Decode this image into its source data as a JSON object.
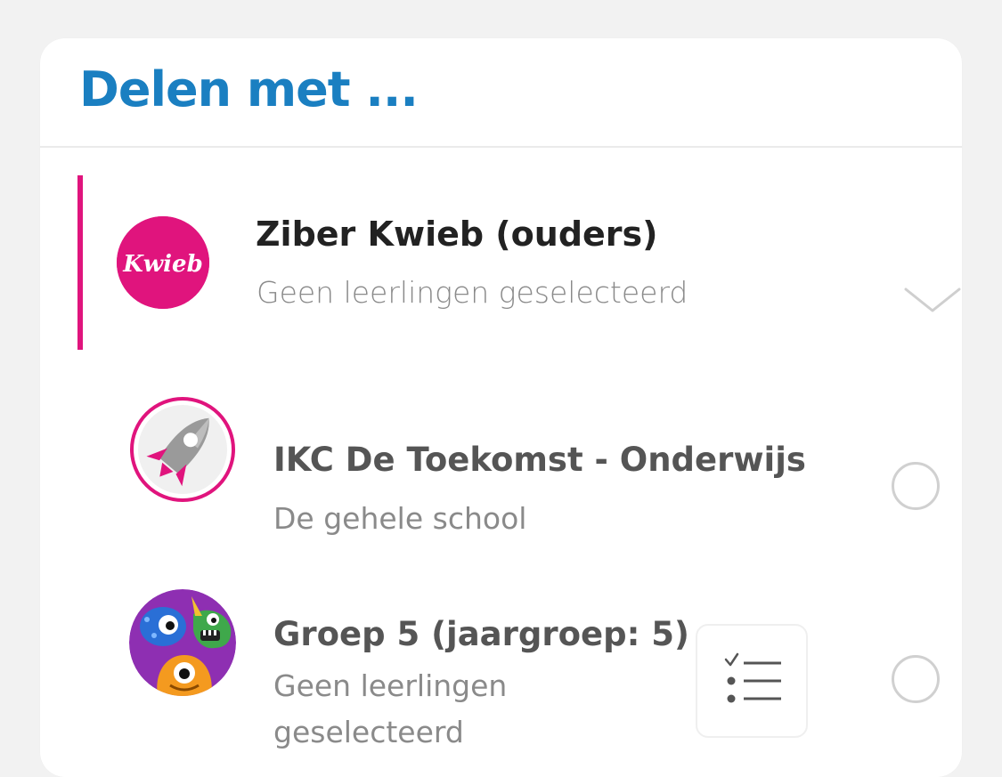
{
  "dialog": {
    "title": "Delen met ..."
  },
  "parent_group": {
    "name": "Ziber Kwieb (ouders)",
    "subtitle": "Geen leerlingen geselecteerd",
    "logo_text": "Kwieb",
    "accent_color": "#e0147d",
    "expand_icon": "chevron-down-icon"
  },
  "items": [
    {
      "name": "IKC De Toekomst - Onderwijs",
      "subtitle": "De gehele school",
      "avatar": "rocket-avatar",
      "selected": false
    },
    {
      "name": "Groep 5 (jaargroep: 5)",
      "subtitle": "Geen leerlingen geselecteerd",
      "avatar": "monsters-avatar",
      "select_students_icon": "checklist-icon",
      "selected": false
    }
  ],
  "colors": {
    "title": "#1a7fc1",
    "accent": "#e0147d",
    "background": "#f2f2f2",
    "card": "#ffffff"
  }
}
